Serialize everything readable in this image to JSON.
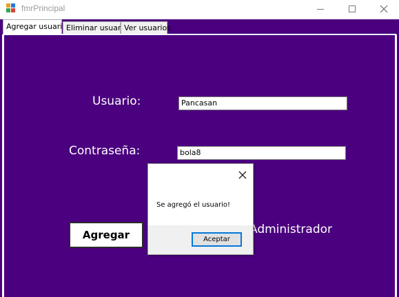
{
  "window": {
    "title": "fmrPrincipal",
    "controls": {
      "minimize": "minimize-icon",
      "maximize": "maximize-icon",
      "close": "close-icon"
    }
  },
  "tabs": [
    {
      "label": "Agregar usuario",
      "active": true
    },
    {
      "label": "Eliminar usuario",
      "active": false
    },
    {
      "label": "Ver usuarios",
      "active": false
    }
  ],
  "form": {
    "usuario_label": "Usuario:",
    "usuario_value": "Pancasan",
    "contrasena_label": "Contraseña:",
    "contrasena_value": "bola8",
    "admin_label": "Administrador",
    "agregar_button": "Agregar"
  },
  "dialog": {
    "message": "Se agregó el usuario!",
    "ok_button": "Aceptar"
  },
  "colors": {
    "panel_background": "#4b007f",
    "text_on_panel": "#ffffff",
    "accent_focus": "#0078d7"
  }
}
